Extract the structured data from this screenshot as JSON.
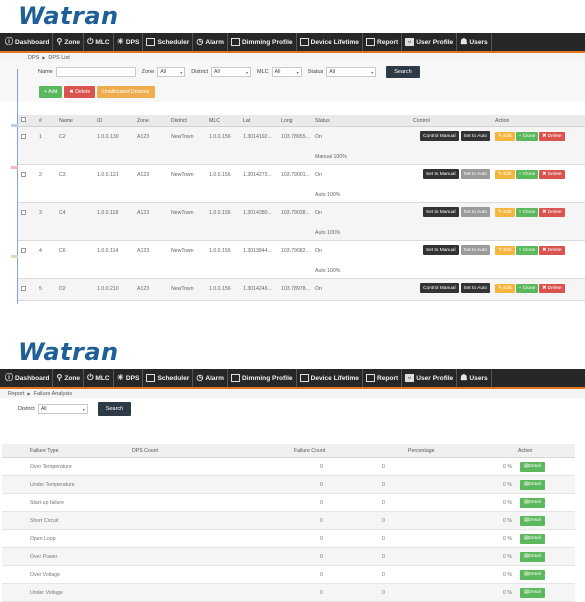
{
  "brand": {
    "logo_text": "Watran",
    "brand_color": "#1d5f96",
    "accent_color": "#e4741d"
  },
  "nav1": {
    "items": [
      {
        "label": "Dashboard",
        "icon": "info-circle-icon"
      },
      {
        "label": "Zone",
        "icon": "map-pin-icon"
      },
      {
        "label": "MLC",
        "icon": "power-icon"
      },
      {
        "label": "DPS",
        "icon": "bulb-icon"
      },
      {
        "label": "Scheduler",
        "icon": "calendar-icon"
      },
      {
        "label": "Alarm",
        "icon": "clock-icon"
      },
      {
        "label": "Dimming Profile",
        "icon": "calendar-icon"
      },
      {
        "label": "Device Lifetime",
        "icon": "document-icon"
      },
      {
        "label": "Report",
        "icon": "document-icon"
      },
      {
        "label": "User Profile",
        "icon": "id-card-icon"
      },
      {
        "label": "Users",
        "icon": "users-icon"
      }
    ]
  },
  "dps": {
    "breadcrumb": [
      "DPS",
      "DPS List"
    ],
    "filters": {
      "name_label": "Name",
      "name_value": "",
      "zone_label": "Zone",
      "zone_value": "All",
      "district_label": "District",
      "district_value": "All",
      "mlc_label": "MLC",
      "mlc_value": "All",
      "status_label": "Status",
      "status_value": "All",
      "search_label": "Search"
    },
    "buttons": {
      "add": "+ Add",
      "delete": "✖ Delete",
      "unallocated": "Unallocated Devices"
    },
    "columns": [
      "#",
      "Name",
      "ID",
      "Zone",
      "District",
      "MLC",
      "Lat",
      "Long",
      "Status",
      "Control",
      "Action"
    ],
    "rows": [
      {
        "num": "1",
        "name": "C2",
        "id": "1.0.0.130",
        "zone": "A123",
        "district": "NewTown",
        "mlc": "1.0.0.156",
        "lat": "1.3014192...",
        "long": "103.78955...",
        "status": "On",
        "mode": "Manual 100%",
        "ctl1": "Control Manual",
        "ctl2": "Set to Auto",
        "ctl1_style": "dark",
        "ctl2_style": "dark"
      },
      {
        "num": "2",
        "name": "C3",
        "id": "1.0.0.121",
        "zone": "A123",
        "district": "NewTown",
        "mlc": "1.0.0.156",
        "lat": "1.3014273...",
        "long": "103.79001...",
        "status": "On",
        "mode": "Auto 100%",
        "ctl1": "Set to Manual",
        "ctl2": "Set to Auto",
        "ctl1_style": "dark",
        "ctl2_style": "gray"
      },
      {
        "num": "3",
        "name": "C4",
        "id": "1.0.0.118",
        "zone": "A123",
        "district": "NewTown",
        "mlc": "1.0.0.156",
        "lat": "1.3014380...",
        "long": "103.79038...",
        "status": "On",
        "mode": "Auto 100%",
        "ctl1": "Set to Manual",
        "ctl2": "Set to Auto",
        "ctl1_style": "dark",
        "ctl2_style": "gray"
      },
      {
        "num": "4",
        "name": "C6",
        "id": "1.0.0.114",
        "zone": "A123",
        "district": "NewTown",
        "mlc": "1.0.0.156",
        "lat": "1.3013844...",
        "long": "103.79082...",
        "status": "On",
        "mode": "Auto 100%",
        "ctl1": "Set to Manual",
        "ctl2": "Set to Auto",
        "ctl1_style": "dark",
        "ctl2_style": "gray"
      },
      {
        "num": "5",
        "name": "D2",
        "id": "1.0.0.210",
        "zone": "A123",
        "district": "NewTown",
        "mlc": "1.0.0.156",
        "lat": "1.3014246...",
        "long": "103.78978...",
        "status": "On",
        "mode": "",
        "ctl1": "Control Manual",
        "ctl2": "Set to Auto",
        "ctl1_style": "dark",
        "ctl2_style": "dark"
      }
    ],
    "row_actions": {
      "edit": "✎ Edit",
      "clone": "+ Clone",
      "delete": "✖ Delete"
    }
  },
  "report": {
    "breadcrumb": [
      "Report",
      "Failure Analysis"
    ],
    "district_label": "District",
    "district_value": "All",
    "search_label": "Search",
    "columns": [
      "Failure Type",
      "DPS Count",
      "Failure Count",
      "Percentage",
      "Action"
    ],
    "rows": [
      {
        "type": "Over Temperature",
        "dps": "",
        "failure": "0",
        "pct_count": "0",
        "pct": "0 %"
      },
      {
        "type": "Under Temperature",
        "dps": "",
        "failure": "0",
        "pct_count": "0",
        "pct": "0 %"
      },
      {
        "type": "Start-up failure",
        "dps": "",
        "failure": "0",
        "pct_count": "0",
        "pct": "0 %"
      },
      {
        "type": "Short Circuit",
        "dps": "",
        "failure": "0",
        "pct_count": "0",
        "pct": "0 %"
      },
      {
        "type": "Open Loop",
        "dps": "",
        "failure": "0",
        "pct_count": "0",
        "pct": "0 %"
      },
      {
        "type": "Over Power",
        "dps": "",
        "failure": "0",
        "pct_count": "0",
        "pct": "0 %"
      },
      {
        "type": "Over Voltage",
        "dps": "",
        "failure": "0",
        "pct_count": "0",
        "pct": "0 %"
      },
      {
        "type": "Under Voltage",
        "dps": "",
        "failure": "0",
        "pct_count": "0",
        "pct": "0 %"
      }
    ],
    "detail_label": "Detail"
  }
}
